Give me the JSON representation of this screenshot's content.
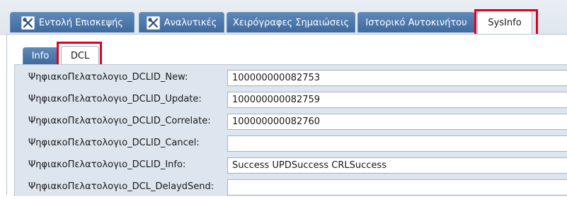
{
  "outer_tabs": [
    {
      "label": "Εντολή Επισκεψής",
      "icon": "wrench-screwdriver-icon",
      "active": false
    },
    {
      "label": "Αναλυτικές",
      "icon": "wrench-screwdriver-icon",
      "active": false
    },
    {
      "label": "Χειρόγραφες Σημαιώσεις",
      "active": false
    },
    {
      "label": "Ιστορικό Αυτοκινήτου",
      "active": false
    },
    {
      "label": "SysInfo",
      "active": true
    }
  ],
  "inner_tabs": [
    {
      "label": "Info",
      "active": false
    },
    {
      "label": "DCL",
      "active": true
    }
  ],
  "fields": [
    {
      "label": "ΨηφιακοΠελατολογιο_DCLID_New:",
      "value": "100000000082753"
    },
    {
      "label": "ΨηφιακοΠελατολογιο_DCLID_Update:",
      "value": "100000000082759"
    },
    {
      "label": "ΨηφιακοΠελατολογιο_DCLID_Correlate:",
      "value": "100000000082760"
    },
    {
      "label": "ΨηφιακοΠελατολογιο_DCLID_Cancel:",
      "value": ""
    },
    {
      "label": "ΨηφιακοΠελατολογιο_DCLID_Info:",
      "value": "Success UPDSuccess CRLSuccess"
    },
    {
      "label": "ΨηφιακοΠελατολογιο_DCL_DelaydSend:",
      "value": ""
    }
  ],
  "colors": {
    "tab_blue": "#4d78aa",
    "highlight": "#e3001b",
    "form_bg": "#dde5ee"
  }
}
